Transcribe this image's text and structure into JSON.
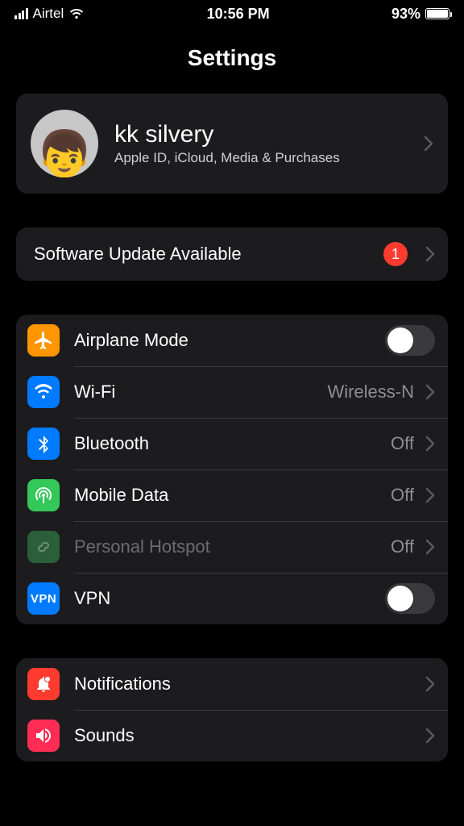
{
  "status": {
    "carrier": "Airtel",
    "time": "10:56 PM",
    "battery_percent": "93%"
  },
  "title": "Settings",
  "profile": {
    "name": "kk silvery",
    "subtitle": "Apple ID, iCloud, Media & Purchases"
  },
  "update": {
    "label": "Software Update Available",
    "badge": "1"
  },
  "network": {
    "airplane": {
      "label": "Airplane Mode"
    },
    "wifi": {
      "label": "Wi-Fi",
      "value": "Wireless-N"
    },
    "bluetooth": {
      "label": "Bluetooth",
      "value": "Off"
    },
    "mobile_data": {
      "label": "Mobile Data",
      "value": "Off"
    },
    "hotspot": {
      "label": "Personal Hotspot",
      "value": "Off"
    },
    "vpn": {
      "label": "VPN"
    }
  },
  "system": {
    "notifications": {
      "label": "Notifications"
    },
    "sounds": {
      "label": "Sounds"
    }
  },
  "colors": {
    "orange": "#ff9500",
    "blue": "#007aff",
    "green": "#34c759",
    "darkgreen": "#2b5f3a",
    "red": "#ff3b30",
    "pink": "#ff2d55"
  }
}
